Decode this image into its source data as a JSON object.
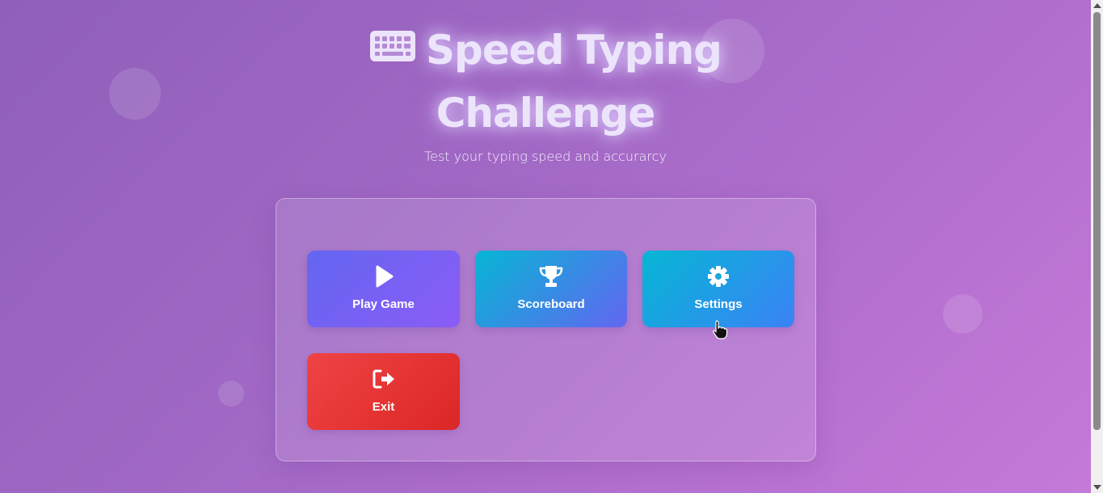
{
  "header": {
    "title_line1": "Speed Typing",
    "title_line2": "Challenge",
    "title_icon": "keyboard-icon",
    "subtitle": "Test your typing speed and accurarcy"
  },
  "menu": {
    "buttons": [
      {
        "label": "Play Game",
        "icon": "play-icon"
      },
      {
        "label": "Scoreboard",
        "icon": "trophy-icon"
      },
      {
        "label": "Settings",
        "icon": "gear-icon"
      },
      {
        "label": "Exit",
        "icon": "exit-icon"
      }
    ]
  },
  "colors": {
    "play": "#6366f1",
    "scoreboard": "#06b6d4",
    "settings": "#3b82f6",
    "exit": "#ef4444"
  }
}
